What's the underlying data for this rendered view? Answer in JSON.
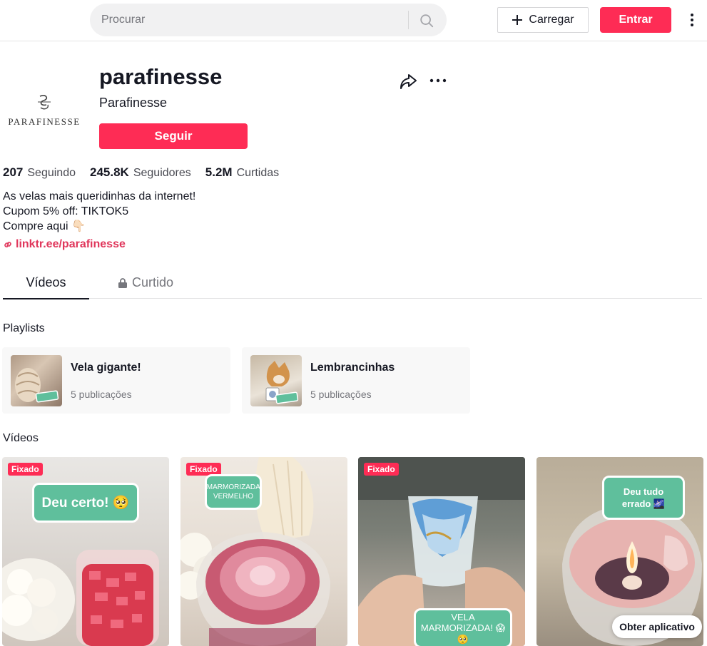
{
  "header": {
    "search_placeholder": "Procurar",
    "upload_label": "Carregar",
    "login_label": "Entrar"
  },
  "profile": {
    "avatar_brand": "PARAFINESSE",
    "username": "parafinesse",
    "nickname": "Parafinesse",
    "follow_label": "Seguir",
    "stats": [
      {
        "value": "207",
        "label": "Seguindo"
      },
      {
        "value": "245.8K",
        "label": "Seguidores"
      },
      {
        "value": "5.2M",
        "label": "Curtidas"
      }
    ],
    "bio": [
      "As velas mais queridinhas da internet!",
      "Cupom 5% off: TIKTOK5",
      "Compre aqui 👇🏻"
    ],
    "link": "linktr.ee/parafinesse"
  },
  "tabs": [
    {
      "label": "Vídeos"
    },
    {
      "label": "Curtido"
    }
  ],
  "playlists_title": "Playlists",
  "playlists": [
    {
      "title": "Vela gigante!",
      "count": "5 publicações"
    },
    {
      "title": "Lembrancinhas",
      "count": "5 publicações"
    }
  ],
  "videos_title": "Vídeos",
  "videos": [
    {
      "pinned": "Fixado",
      "caption": "Deu certo! 🥺"
    },
    {
      "pinned": "Fixado",
      "caption": "MARMORIZADA VERMELHO"
    },
    {
      "pinned": "Fixado",
      "caption": "VELA MARMORIZADA! 😱🥺"
    },
    {
      "pinned": "",
      "caption": "Deu tudo errado 🌌"
    }
  ],
  "get_app_label": "Obter aplicativo",
  "colors": {
    "accent": "#fe2c55",
    "bubble": "#5fbf9c"
  }
}
